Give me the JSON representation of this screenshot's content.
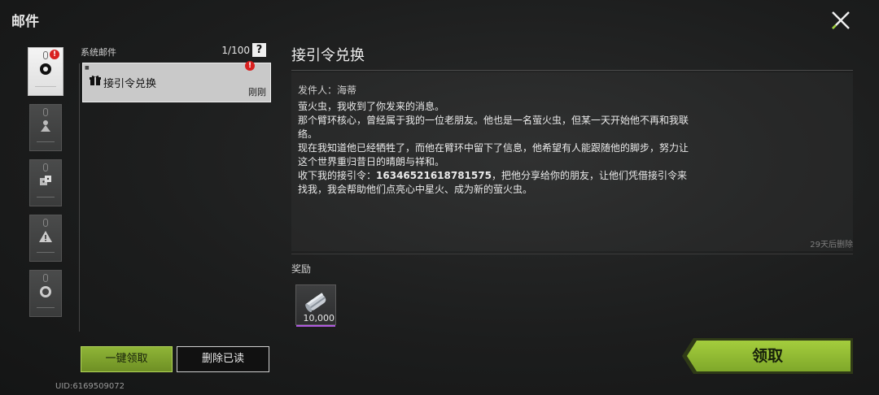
{
  "header": {
    "title": "邮件"
  },
  "categories": [
    {
      "icon": "gear-badge-icon",
      "badge": "!"
    },
    {
      "icon": "person-icon"
    },
    {
      "icon": "dice-icon"
    },
    {
      "icon": "warning-icon"
    },
    {
      "icon": "face-icon"
    }
  ],
  "list": {
    "label": "系统邮件",
    "count": "1/100",
    "help": "?",
    "items": [
      {
        "subject": "接引令兑换",
        "time": "刚刚",
        "badge": "!"
      }
    ]
  },
  "buttons": {
    "claim_all": "一键领取",
    "delete_read": "删除已读",
    "claim": "领取"
  },
  "uid": "UID:6169509072",
  "detail": {
    "title": "接引令兑换",
    "sender": "发件人：海蒂",
    "body_lines": [
      "萤火虫，我收到了你发来的消息。",
      "那个臂环核心，曾经属于我的一位老朋友。他也是一名萤火虫，但某一天开始他不再和我联络。",
      "现在我知道他已经牺牲了，而他在臂环中留下了信息，他希望有人能跟随他的脚步，努力让这个世界重归昔日的晴朗与祥和。"
    ],
    "code_prefix": "收下我的接引令：",
    "code": "16346521618781575",
    "code_suffix": "，把他分享给你的朋友，让他们凭借接引令来找我，我会帮助他们点亮心中星火、成为新的萤火虫。",
    "expire": "29天后删除"
  },
  "reward": {
    "label": "奖励",
    "icon": "currency-stack-icon",
    "amount": "10,000",
    "rarity_color": "#b05ae0"
  },
  "colors": {
    "accent": "#8fb537",
    "badge": "#d9201f"
  }
}
